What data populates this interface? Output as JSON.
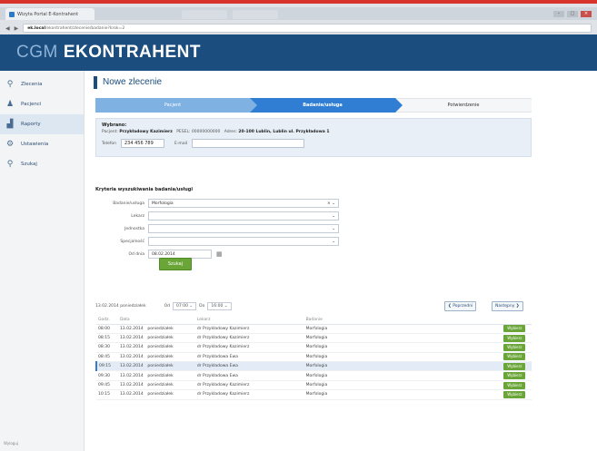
{
  "browser": {
    "tab_title": "Wizyta Portal E-Kontrahent",
    "tab_inactive_1": "",
    "tab_inactive_2": "",
    "url_host": "ek.local",
    "url_rest": "/ekontrahent/zlecenie/badanie?krok=2",
    "back_icon": "back-arrow-icon",
    "forward_icon": "forward-arrow-icon"
  },
  "app": {
    "brand_prefix": "CGM",
    "brand_name": "EKONTRAHENT"
  },
  "sidebar": {
    "items": [
      {
        "label": "Zlecenia",
        "icon": "orders-icon"
      },
      {
        "label": "Pacjenci",
        "icon": "patient-icon"
      },
      {
        "label": "Raporty",
        "icon": "chart-icon"
      },
      {
        "label": "Ustawienia",
        "icon": "settings-icon"
      },
      {
        "label": "Szukaj",
        "icon": "search-icon"
      }
    ],
    "footer": "Wyloguj"
  },
  "page": {
    "title": "Nowe zlecenie"
  },
  "steps": {
    "step1": "Pacjent",
    "step2": "Badanie/usługa",
    "step3": "Potwierdzenie"
  },
  "patient": {
    "title": "Wybrano:",
    "patient_label": "Pacjent:",
    "patient_name": "Przykładowy Kazimierz",
    "pesel_label": "PESEL:",
    "pesel_value": "00000000000",
    "address_label": "Adres:",
    "address_value": "20-100 Lublin, Lublin ul. Przykładowa 1",
    "phone_label": "Telefon",
    "phone_value": "234 456 789",
    "email_label": "E-mail",
    "email_value": ""
  },
  "criteria": {
    "title": "Kryteria wyszukiwania badania/usługi",
    "rows": [
      {
        "label": "Badanie/usługa",
        "value": "Morfologia",
        "clear": true
      },
      {
        "label": "Lekarz",
        "value": ""
      },
      {
        "label": "Jednostka",
        "value": ""
      },
      {
        "label": "Specjalność",
        "value": ""
      }
    ],
    "date_label": "Od dnia",
    "date_value": "08.02.2014",
    "search_label": "Szukaj"
  },
  "toolbar": {
    "date_text": "13.02.2014 poniedziałek",
    "from_label": "Od",
    "from_value": "07:00",
    "to_label": "Do",
    "to_value": "16:00",
    "prev_label": "Poprzedni",
    "next_label": "Następny"
  },
  "table": {
    "headers": [
      "Godz.",
      "Data",
      "",
      "Lekarz",
      "Badanie",
      ""
    ],
    "rows": [
      {
        "time": "08:00",
        "date": "13.02.2014",
        "day": "poniedziałek",
        "doctor": "dr Przykładowy Kazimierz",
        "exam": "Morfologia",
        "action": "Wybierz"
      },
      {
        "time": "08:15",
        "date": "13.02.2014",
        "day": "poniedziałek",
        "doctor": "dr Przykładowy Kazimierz",
        "exam": "Morfologia",
        "action": "Wybierz"
      },
      {
        "time": "08:30",
        "date": "13.02.2014",
        "day": "poniedziałek",
        "doctor": "dr Przykładowy Kazimierz",
        "exam": "Morfologia",
        "action": "Wybierz"
      },
      {
        "time": "08:45",
        "date": "13.02.2014",
        "day": "poniedziałek",
        "doctor": "dr Przykładowa Ewa",
        "exam": "Morfologia",
        "action": "Wybierz"
      },
      {
        "time": "09:15",
        "date": "13.02.2014",
        "day": "poniedziałek",
        "doctor": "dr Przykładowa Ewa",
        "exam": "Morfologia",
        "action": "Wybierz"
      },
      {
        "time": "09:30",
        "date": "13.02.2014",
        "day": "poniedziałek",
        "doctor": "dr Przykładowa Ewa",
        "exam": "Morfologia",
        "action": "Wybierz"
      },
      {
        "time": "09:45",
        "date": "13.02.2014",
        "day": "poniedziałek",
        "doctor": "dr Przykładowy Kazimierz",
        "exam": "Morfologia",
        "action": "Wybierz"
      },
      {
        "time": "10:15",
        "date": "13.02.2014",
        "day": "poniedziałek",
        "doctor": "dr Przykładowy Kazimierz",
        "exam": "Morfologia",
        "action": "Wybierz"
      }
    ]
  }
}
